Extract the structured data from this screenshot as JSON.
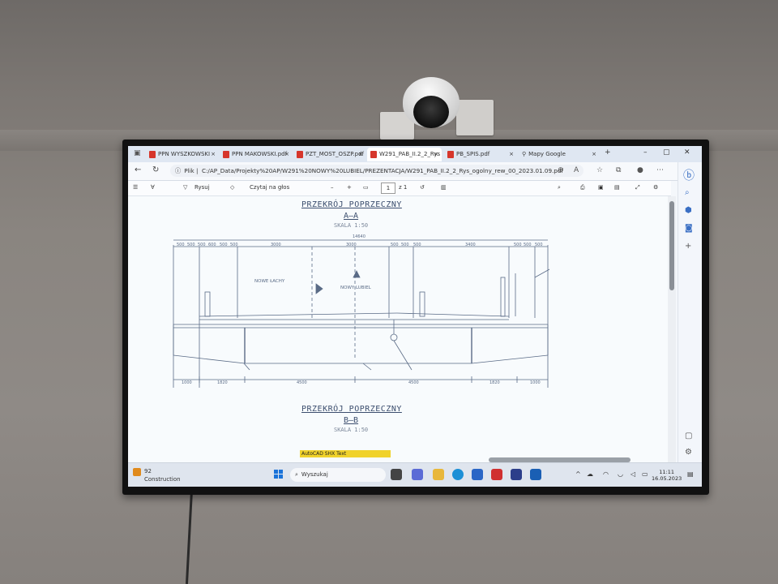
{
  "browser": {
    "tabs": [
      {
        "label": "PPN WYSZKOWSKI",
        "active": false
      },
      {
        "label": "PPN MAKOWSKI.pdf",
        "active": false
      },
      {
        "label": "PZT_MOST_OSZP.pdf",
        "active": false
      },
      {
        "label": "W291_PAB_II.2_2_Rys",
        "active": true
      },
      {
        "label": "PB_SPIS.pdf",
        "active": false
      },
      {
        "label": "Mapy Google",
        "active": false
      }
    ],
    "address_label": "Plik",
    "url": "C:/AP_Data/Projekty%20AP/W291%20NOWY%20LUBIEL/PREZENTACJA/W291_PAB_II.2_2_Rys_ogolny_rew_00_2023.01.09.pdf"
  },
  "pdf_toolbar": {
    "draw_label": "Rysuj",
    "read_aloud_label": "Czytaj na głos",
    "page_current": "1",
    "page_total": "z 1"
  },
  "drawing": {
    "section_a_title": "PRZEKRÓJ POPRZECZNY",
    "section_a_sub": "A—A",
    "section_a_scale": "SKALA 1:50",
    "section_b_title": "PRZEKRÓJ POPRZECZNY",
    "section_b_sub": "B—B",
    "section_b_scale": "SKALA 1:50",
    "label_nowe_lachy": "NOWE ŁACHY",
    "label_nowy_lubiel": "NOWY LUBIEL",
    "overall_dim": "14640",
    "top_dims": [
      "500",
      "500",
      "500",
      "600",
      "500",
      "500",
      "3000",
      "3000",
      "500",
      "500",
      "500",
      "3400",
      "500",
      "500",
      "500"
    ],
    "bottom_dims": [
      "1000",
      "1820",
      "4500",
      "4500",
      "1820",
      "1000"
    ],
    "autocad_tag": "AutoCAD SHX Text"
  },
  "taskbar": {
    "weather_temp": "92",
    "weather_text": "Construction",
    "search_label": "Wyszukaj",
    "time": "11:11",
    "date": "16.05.2023"
  },
  "colors": {
    "accent": "#1a73d9",
    "drawing_ink": "#3c4e6e",
    "pdf_icon": "#d6362c",
    "autocad_tag_bg": "#f0d22a"
  }
}
